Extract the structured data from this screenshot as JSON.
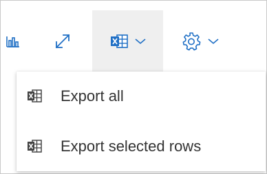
{
  "colors": {
    "accent_blue": "#1f6fc5",
    "text": "#333333",
    "icon_dark": "#444444",
    "selected_background": "#efefef"
  },
  "toolbar": {
    "buttons": [
      {
        "icon": "bar-chart-icon"
      },
      {
        "icon": "expand-diagonal-icon"
      },
      {
        "icon": "excel-table-icon",
        "dropdown_icon": "chevron-down-icon",
        "state": "open"
      },
      {
        "icon": "gear-icon",
        "dropdown_icon": "chevron-down-icon"
      }
    ]
  },
  "export_menu": {
    "items": [
      {
        "icon": "excel-table-icon",
        "label": "Export all"
      },
      {
        "icon": "excel-table-icon",
        "label": "Export selected rows"
      }
    ]
  }
}
